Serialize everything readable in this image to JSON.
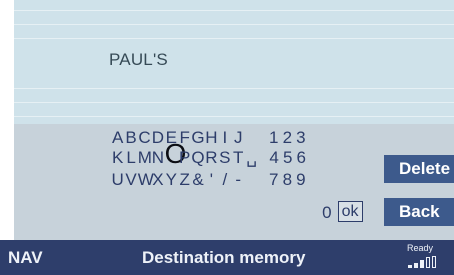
{
  "entry": {
    "text": "PAUL'S"
  },
  "keyboard": {
    "row1": {
      "letters": [
        "A",
        "B",
        "C",
        "D",
        "E",
        "F",
        "G",
        "H",
        "I",
        "J"
      ],
      "digits": [
        "1",
        "2",
        "3"
      ]
    },
    "row2": {
      "letters_before": [
        "K",
        "L",
        "M",
        "N"
      ],
      "selected": "O",
      "letters_after": [
        "P",
        "Q",
        "R",
        "S",
        "T",
        "␣"
      ],
      "digits": [
        "4",
        "5",
        "6"
      ]
    },
    "row3": {
      "letters": [
        "U",
        "V",
        "W",
        "X",
        "Y",
        "Z",
        "&",
        "'",
        "/",
        "-"
      ],
      "digits": [
        "7",
        "8",
        "9"
      ]
    },
    "row4": {
      "digit": "0",
      "ok_label": "ok"
    }
  },
  "buttons": {
    "delete_label": "Delete",
    "back_label": "Back"
  },
  "status_bar": {
    "nav_label": "NAV",
    "title": "Destination memory",
    "ready_label": "Ready",
    "signal_icon": "signal-strength-icon"
  },
  "colors": {
    "entry_bg": "#cfe2ea",
    "keyboard_bg": "#c7d2da",
    "button_bg": "#3d5a8c",
    "status_bg": "#2e3e6b",
    "key_text": "#2d3d6a"
  }
}
